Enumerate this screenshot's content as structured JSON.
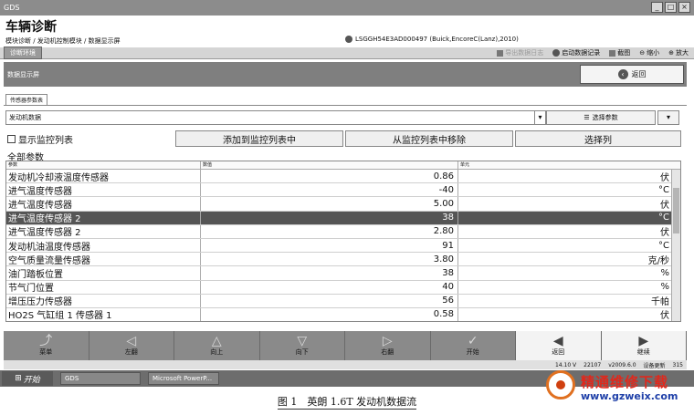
{
  "window": {
    "title": "GDS",
    "controls": [
      "_",
      "□",
      "×"
    ]
  },
  "app_title": "车辆诊断",
  "breadcrumb": "模块诊断 / 发动机控制模块 / 数据显示屏",
  "vin_info": "LSGGH54E3AD000497 (Buick,EncoreC(Lanz),2010)",
  "tab": {
    "active": "诊断环境"
  },
  "tools": {
    "export": "导出数据日志",
    "record": "启动数据记录",
    "screenshot": "截图",
    "zoom_out": "缩小",
    "zoom_in": "放大"
  },
  "section_title": "数据显示屏",
  "back_button": "返回",
  "subtab": "传感器参数表",
  "selector": {
    "value": "发动机数据",
    "button": "选择参数"
  },
  "actions": {
    "show_monitor": "显示监控列表",
    "add": "添加到监控列表中",
    "remove": "从监控列表中移除",
    "select_cols": "选择列"
  },
  "all_params": "全部参数",
  "table": {
    "headers": [
      "参数",
      "数值",
      "单元"
    ],
    "selected_index": 3,
    "rows": [
      {
        "name": "发动机冷却液温度传感器",
        "value": "0.86",
        "unit": "伏"
      },
      {
        "name": "进气温度传感器",
        "value": "-40",
        "unit": "°C"
      },
      {
        "name": "进气温度传感器",
        "value": "5.00",
        "unit": "伏"
      },
      {
        "name": "进气温度传感器 2",
        "value": "38",
        "unit": "°C"
      },
      {
        "name": "进气温度传感器 2",
        "value": "2.80",
        "unit": "伏"
      },
      {
        "name": "发动机油温度传感器",
        "value": "91",
        "unit": "°C"
      },
      {
        "name": "空气质量流量传感器",
        "value": "3.80",
        "unit": "克/秒"
      },
      {
        "name": "油门踏板位置",
        "value": "38",
        "unit": "%"
      },
      {
        "name": "节气门位置",
        "value": "40",
        "unit": "%"
      },
      {
        "name": "增压压力传感器",
        "value": "56",
        "unit": "千帕"
      },
      {
        "name": "HO2S 气缸组 1 传感器 1",
        "value": "0.58",
        "unit": "伏"
      }
    ]
  },
  "toolbar": [
    {
      "label": "菜单",
      "icon": "menu-icon",
      "glyph": "⤴"
    },
    {
      "label": "左翻",
      "icon": "page-left-icon",
      "glyph": "◁"
    },
    {
      "label": "向上",
      "icon": "up-icon",
      "glyph": "△"
    },
    {
      "label": "向下",
      "icon": "down-icon",
      "glyph": "▽"
    },
    {
      "label": "右翻",
      "icon": "page-right-icon",
      "glyph": "▷"
    },
    {
      "label": "开始",
      "icon": "check-icon",
      "glyph": "✓"
    },
    {
      "label": "返回",
      "icon": "back-icon",
      "glyph": "◀"
    },
    {
      "label": "继续",
      "icon": "continue-icon",
      "glyph": "▶"
    }
  ],
  "status": {
    "voltage": "14.10 V",
    "id": "22107",
    "version": "v2009.6.0",
    "connected": "设备更新",
    "code": "315"
  },
  "taskbar": {
    "start": "开始",
    "task1": "GDS",
    "task2": "Microsoft PowerP..."
  },
  "watermark": {
    "line1": "精通维修下载",
    "line2": "www.gzweix.com"
  },
  "caption": "图 1　英朗 1.6T 发动机数据流"
}
